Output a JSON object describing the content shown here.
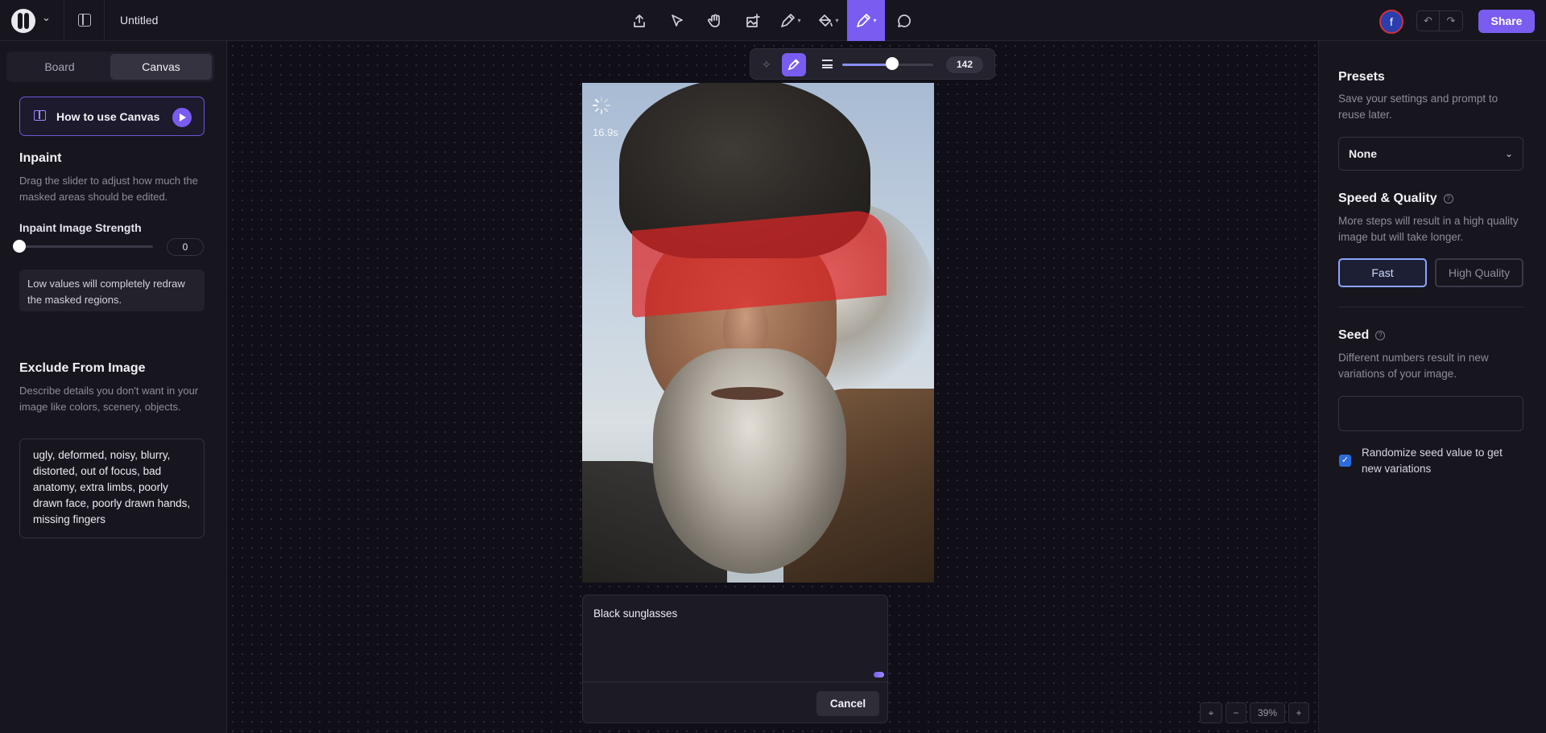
{
  "app": {
    "title": "Untitled",
    "share_label": "Share",
    "avatar_initial": "f",
    "accent_color": "#7a5cf0"
  },
  "toolbar": {
    "tools": [
      {
        "icon": "upload-icon",
        "active": false
      },
      {
        "icon": "pointer-icon",
        "active": false
      },
      {
        "icon": "hand-icon",
        "active": false
      },
      {
        "icon": "add-image-icon",
        "active": false
      },
      {
        "icon": "pen-icon",
        "active": false
      },
      {
        "icon": "fill-icon",
        "active": false
      },
      {
        "icon": "inpaint-brush-icon",
        "active": true
      },
      {
        "icon": "comment-icon",
        "active": false
      }
    ]
  },
  "sidebar_left": {
    "tabs": [
      "Board",
      "Canvas"
    ],
    "active_tab": "Canvas",
    "howto_label": "How to use Canvas",
    "inpaint_title": "Inpaint",
    "inpaint_desc": "Drag the slider to adjust how much the masked areas should be edited.",
    "strength_label": "Inpaint Image Strength",
    "strength_value": "0",
    "note": "Low values will completely redraw the masked regions.",
    "exclude_title": "Exclude From Image",
    "exclude_desc": "Describe details you don't want in your image like colors, scenery, objects.",
    "negative_prompt": "ugly, deformed, noisy, blurry, distorted, out of focus, bad anatomy, extra limbs, poorly drawn face, poorly drawn hands, missing fingers"
  },
  "brush": {
    "size_value": "142",
    "size_fraction": 0.55
  },
  "canvas": {
    "timer": "16.9s",
    "prompt_text": "Black sunglasses",
    "cancel_label": "Cancel",
    "zoom_minus": "−",
    "zoom_level": "39%",
    "zoom_plus": "+"
  },
  "sidebar_right": {
    "presets_title": "Presets",
    "presets_desc": "Save your settings and prompt to reuse later.",
    "preset_selected": "None",
    "sq_title": "Speed & Quality",
    "sq_desc": "More steps will result in a high quality image but will take longer.",
    "sq_fast": "Fast",
    "sq_hq": "High Quality",
    "sq_selected": "Fast",
    "seed_title": "Seed",
    "seed_desc": "Different numbers result in new variations of your image.",
    "seed_value": "",
    "randomize_label": "Randomize seed value to get new variations",
    "randomize_checked": true
  }
}
